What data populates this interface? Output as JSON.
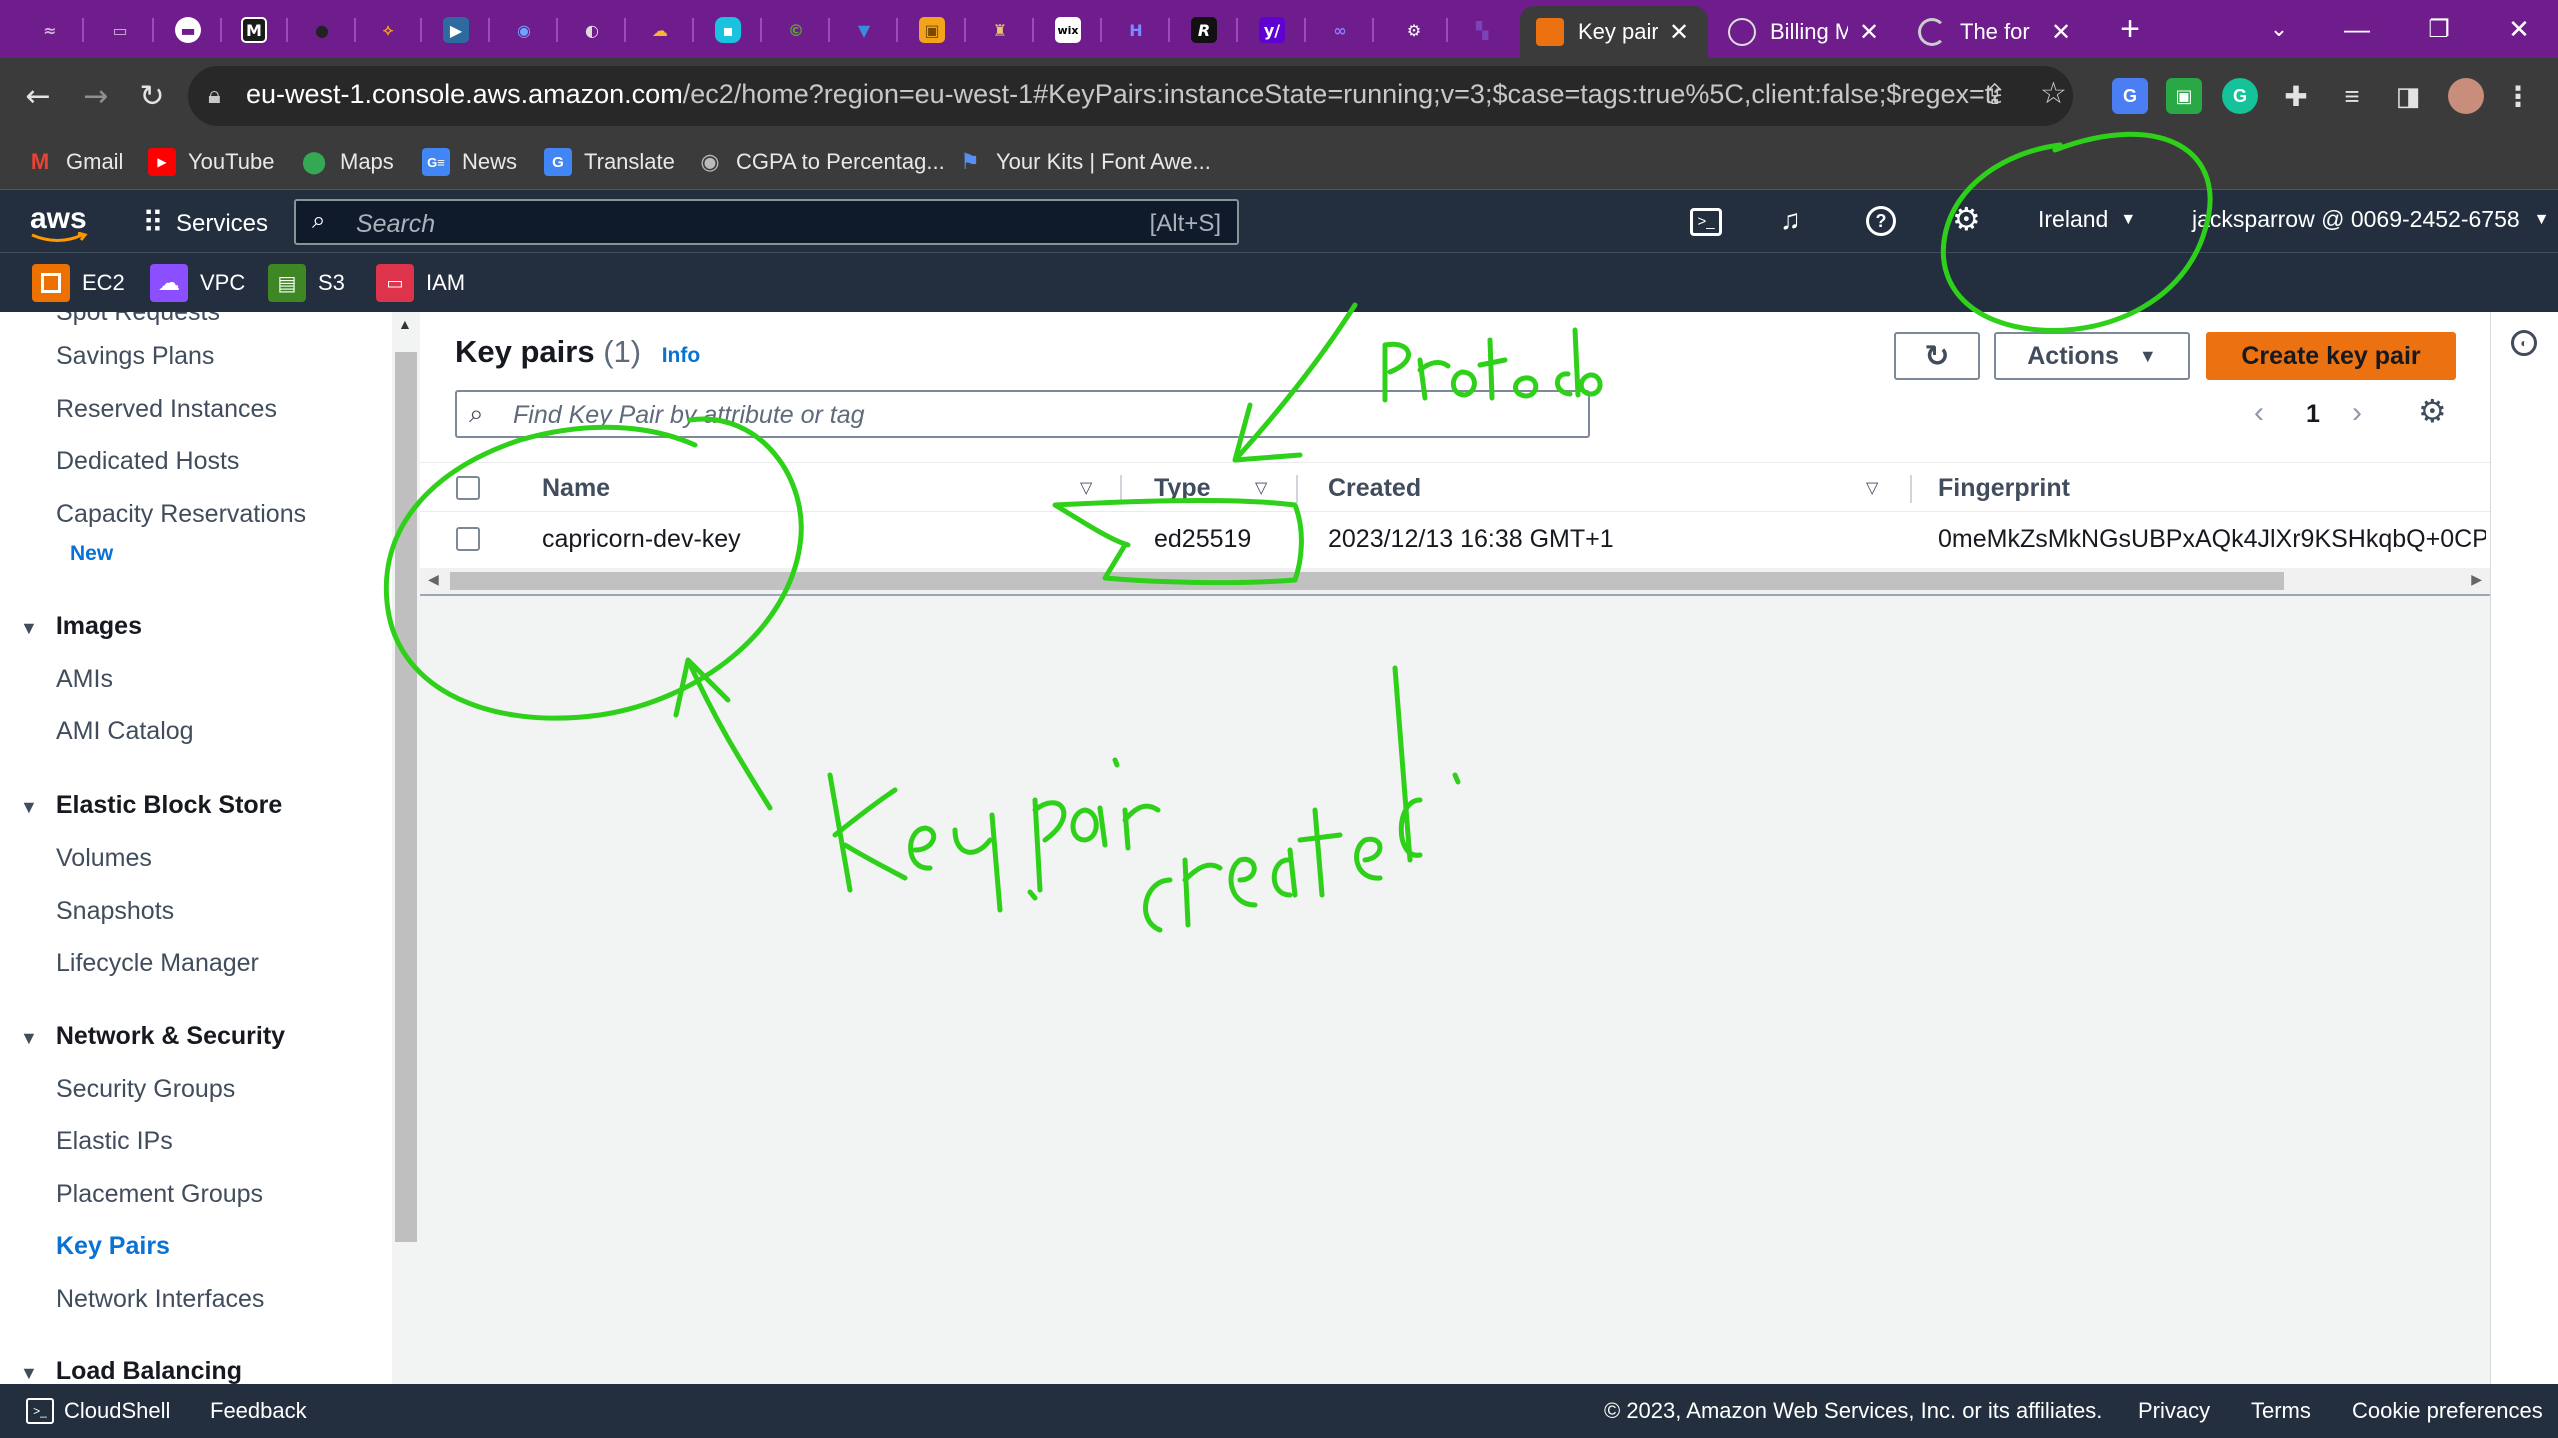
{
  "browser": {
    "tabs": [
      {
        "title": "Key pair",
        "active": true
      },
      {
        "title": "Billing M",
        "active": false
      },
      {
        "title": "The for",
        "active": false
      }
    ],
    "new_tab_label": "+",
    "url_host": "eu-west-1.console.aws.amazon.com",
    "url_rest": "/ec2/home?region=eu-west-1#KeyPairs:instanceState=running;v=3;$case=tags:true%5C,client:false;$regex=tags:false%5C,...",
    "bookmarks": [
      "Gmail",
      "YouTube",
      "Maps",
      "News",
      "Translate",
      "CGPA to Percentag...",
      "Your Kits | Font Awe..."
    ],
    "pinned_labels": {
      "wix": "wix",
      "r": "R",
      "y": "y/"
    }
  },
  "aws": {
    "logo": "aws",
    "services_label": "Services",
    "search_placeholder": "Search",
    "search_shortcut": "[Alt+S]",
    "region": "Ireland",
    "account": "jacksparrow @ 0069-2452-6758",
    "favorites": [
      "EC2",
      "VPC",
      "S3",
      "IAM"
    ]
  },
  "sidebar": {
    "partial_top": "Spot Requests",
    "items_top": [
      "Savings Plans",
      "Reserved Instances",
      "Dedicated Hosts",
      "Capacity Reservations"
    ],
    "new_badge": "New",
    "images": {
      "title": "Images",
      "items": [
        "AMIs",
        "AMI Catalog"
      ]
    },
    "ebs": {
      "title": "Elastic Block Store",
      "items": [
        "Volumes",
        "Snapshots",
        "Lifecycle Manager"
      ]
    },
    "netsec": {
      "title": "Network & Security",
      "items": [
        "Security Groups",
        "Elastic IPs",
        "Placement Groups",
        "Key Pairs",
        "Network Interfaces"
      ]
    },
    "lb": {
      "title": "Load Balancing"
    }
  },
  "main": {
    "title": "Key pairs",
    "count": "(1)",
    "info": "Info",
    "actions": "Actions",
    "create": "Create key pair",
    "filter_placeholder": "Find Key Pair by attribute or tag",
    "page": "1",
    "columns": [
      "Name",
      "Type",
      "Created",
      "Fingerprint"
    ],
    "rows": [
      {
        "name": "capricorn-dev-key",
        "type": "ed25519",
        "created": "2023/12/13 16:38 GMT+1",
        "fingerprint": "0meMkZsMkNGsUBPxAQk4JlXr9KSHkqbQ+0CP..."
      }
    ]
  },
  "footer": {
    "cloudshell": "CloudShell",
    "feedback": "Feedback",
    "copyright": "© 2023, Amazon Web Services, Inc. or its affiliates.",
    "privacy": "Privacy",
    "terms": "Terms",
    "cookies": "Cookie preferences"
  },
  "colors": {
    "aws_nav": "#232f3e",
    "aws_orange": "#ec7211",
    "link": "#0972d3",
    "chrome_tabstrip": "#6f1c8c",
    "annotation": "#2fd01a"
  }
}
